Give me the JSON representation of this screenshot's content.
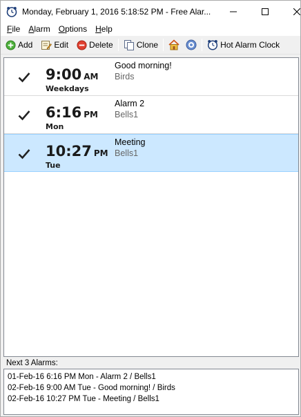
{
  "window": {
    "title": "Monday, February 1, 2016 5:18:52 PM - Free Alar..."
  },
  "menu": [
    {
      "accel": "F",
      "rest": "ile"
    },
    {
      "accel": "A",
      "rest": "larm"
    },
    {
      "accel": "O",
      "rest": "ptions"
    },
    {
      "accel": "H",
      "rest": "elp"
    }
  ],
  "toolbar": {
    "add": "Add",
    "edit": "Edit",
    "delete": "Delete",
    "clone": "Clone",
    "hot_alarm_clock": "Hot Alarm Clock"
  },
  "alarms": [
    {
      "checked": true,
      "time": "9:00",
      "ampm": "AM",
      "days": "Weekdays",
      "name": "Good morning!",
      "sound": "Birds",
      "selected": false
    },
    {
      "checked": true,
      "time": "6:16",
      "ampm": "PM",
      "days": "Mon",
      "name": "Alarm 2",
      "sound": "Bells1",
      "selected": false
    },
    {
      "checked": true,
      "time": "10:27",
      "ampm": "PM",
      "days": "Tue",
      "name": "Meeting",
      "sound": "Bells1",
      "selected": true
    }
  ],
  "next": {
    "label": "Next 3 Alarms:",
    "lines": [
      "01-Feb-16 6:16 PM Mon - Alarm 2 / Bells1",
      "02-Feb-16 9:00 AM Tue - Good morning! / Birds",
      "02-Feb-16 10:27 PM Tue - Meeting / Bells1"
    ]
  },
  "colors": {
    "selection": "#cce8ff",
    "selection_border": "#99d1ff",
    "sound_text": "#666666"
  },
  "icons": {
    "app": "alarm-clock-icon",
    "add": "plus-circle-icon",
    "edit": "edit-icon",
    "delete": "minus-circle-icon",
    "clone": "copy-icon",
    "home": "home-icon",
    "help": "help-icon",
    "hot_alarm_clock": "alarm-clock-icon"
  }
}
